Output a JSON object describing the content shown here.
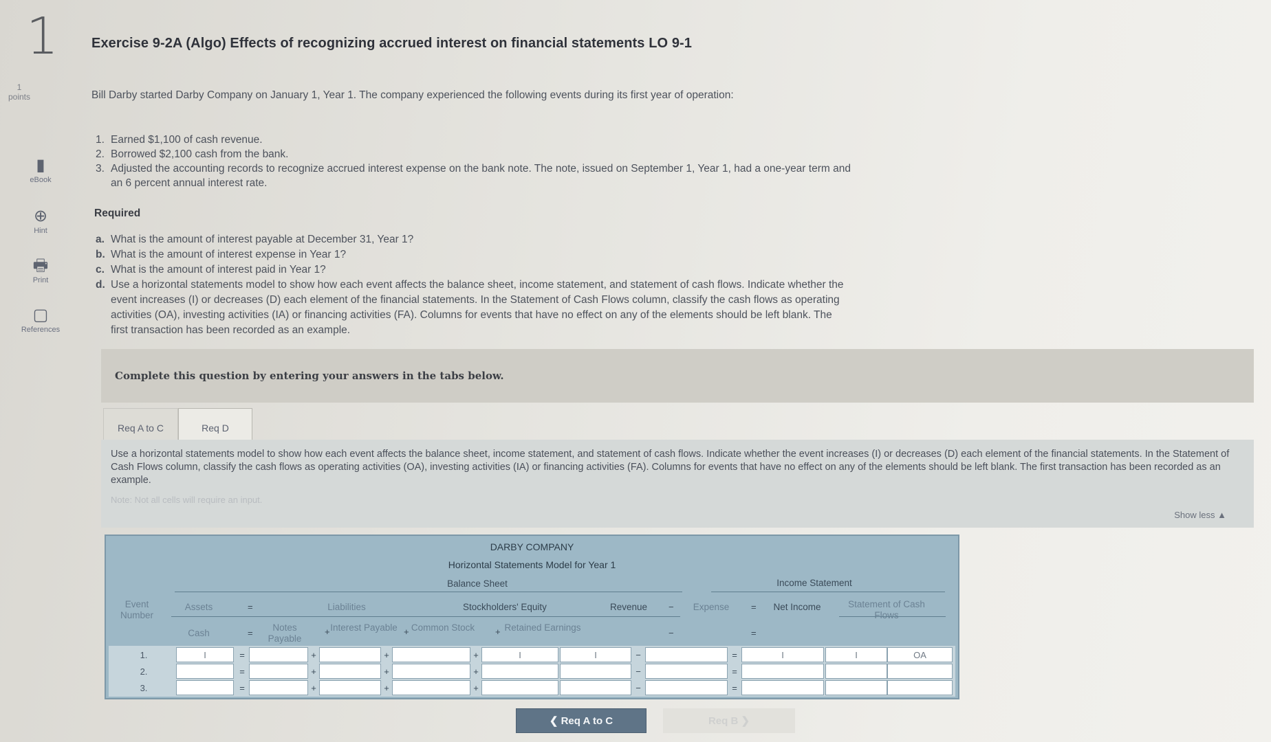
{
  "question": {
    "number": "1",
    "points": "1\npoints"
  },
  "rail": [
    {
      "label": "eBook",
      "icon": "book-icon"
    },
    {
      "label": "Hint",
      "icon": "hint-icon"
    },
    {
      "label": "Print",
      "icon": "print-icon"
    },
    {
      "label": "References",
      "icon": "references-icon"
    }
  ],
  "title": "Exercise 9-2A (Algo) Effects of recognizing accrued interest on financial statements LO 9-1",
  "intro": "Bill Darby started Darby Company on January 1, Year 1. The company experienced the following events during its first year of operation:",
  "events": [
    {
      "num": "1.",
      "text": "Earned $1,100 of cash revenue."
    },
    {
      "num": "2.",
      "text": "Borrowed $2,100 cash from the bank."
    },
    {
      "num": "3.",
      "text": "Adjusted the accounting records to recognize accrued interest expense on the bank note. The note, issued on September 1, Year 1, had a one-year term and an 6 percent annual interest rate."
    }
  ],
  "required_label": "Required",
  "requirements": [
    {
      "letter": "a.",
      "text": "What is the amount of interest payable at December 31, Year 1?"
    },
    {
      "letter": "b.",
      "text": "What is the amount of interest expense in Year 1?"
    },
    {
      "letter": "c.",
      "text": "What is the amount of interest paid in Year 1?"
    },
    {
      "letter": "d.",
      "text": "Use a horizontal statements model to show how each event affects the balance sheet, income statement, and statement of cash flows. Indicate whether the event increases (I) or decreases (D) each element of the financial statements. In the Statement of Cash Flows column, classify the cash flows as operating activities (OA), investing activities (IA) or financing activities (FA). Columns for events that have no effect on any of the elements should be left blank. The first transaction has been recorded as an example."
    }
  ],
  "banner": "Complete this question by entering your answers in the tabs below.",
  "tabs": [
    {
      "label": "Req A to C",
      "active": false
    },
    {
      "label": "Req D",
      "active": true
    }
  ],
  "panel": {
    "description": "Use a horizontal statements model to show how each event affects the balance sheet, income statement, and statement of cash flows. Indicate whether the event increases (I) or decreases (D) each element of the financial statements. In the Statement of Cash Flows column, classify the cash flows as operating activities (OA), investing activities (IA) or financing activities (FA). Columns for events that have no effect on any of the elements should be left blank. The first transaction has been recorded as an example.",
    "note": "Note: Not all cells will require an input.",
    "show_less": "Show less ▲"
  },
  "sheet": {
    "company": "DARBY COMPANY",
    "subtitle": "Horizontal Statements Model for Year 1",
    "balance_sheet": "Balance Sheet",
    "income_statement": "Income Statement",
    "event_number": "Event Number",
    "assets": "Assets",
    "liabilities": "Liabilities",
    "equity": "Stockholders' Equity",
    "revenue": "Revenue",
    "expense": "Expense",
    "net_income": "Net Income",
    "cash_flows": "Statement of Cash Flows",
    "cash": "Cash",
    "notes_payable": "Notes Payable",
    "interest_payable": "Interest Payable",
    "common_stock": "Common Stock",
    "retained_earnings": "Retained Earnings",
    "ops": {
      "eq": "=",
      "plus": "+",
      "minus": "−"
    },
    "rows": [
      {
        "event": "1.",
        "cash": "I",
        "notes": "",
        "interest": "",
        "common": "",
        "retained": "I",
        "revenue": "I",
        "expense": "",
        "net": "I",
        "cf_dir": "I",
        "cf_class": "OA"
      },
      {
        "event": "2.",
        "cash": "",
        "notes": "",
        "interest": "",
        "common": "",
        "retained": "",
        "revenue": "",
        "expense": "",
        "net": "",
        "cf_dir": "",
        "cf_class": ""
      },
      {
        "event": "3.",
        "cash": "",
        "notes": "",
        "interest": "",
        "common": "",
        "retained": "",
        "revenue": "",
        "expense": "",
        "net": "",
        "cf_dir": "",
        "cf_class": ""
      }
    ]
  },
  "nav": {
    "prev": "❮  Req A to C",
    "next": "Req B  ❯"
  }
}
